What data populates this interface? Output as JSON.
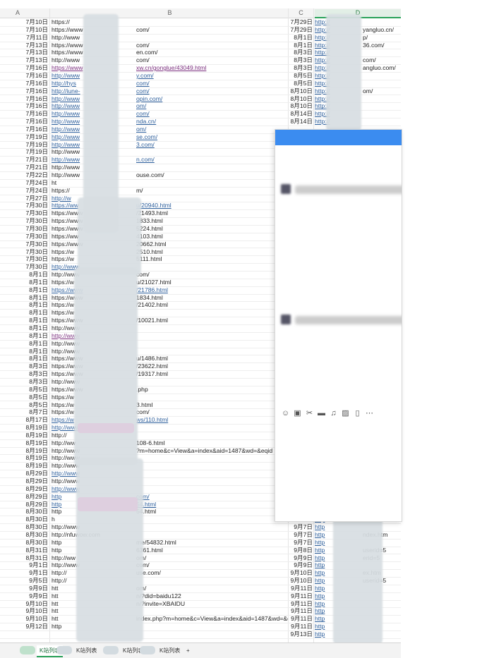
{
  "sheet": {
    "columns": [
      "A",
      "B",
      "C",
      "D"
    ],
    "rows": [
      {
        "a": "7月10日",
        "b": "https://",
        "bs": "",
        "c": "7月29日",
        "d": "http://"
      },
      {
        "a": "7月10日",
        "b": "https://www",
        "bs": "",
        "c": "7月29日",
        "d": "http://"
      },
      {
        "a": "7月11日",
        "b": "http://www",
        "bs": "",
        "c": "8月1日",
        "d": "http://"
      },
      {
        "a": "7月13日",
        "b": "https://www",
        "bs": "",
        "c": "8月1日",
        "d": "http://"
      },
      {
        "a": "7月13日",
        "b": "https://www",
        "bs": "",
        "c": "8月3日",
        "d": "http://"
      },
      {
        "a": "7月13日",
        "b": "http://www",
        "bs": "",
        "c": "8月3日",
        "d": "http://"
      },
      {
        "a": "7月16日",
        "b": "https://www",
        "bs": "visited",
        "c": "8月3日",
        "d": "http://"
      },
      {
        "a": "7月16日",
        "b": "http://www",
        "bs": "link",
        "c": "8月5日",
        "d": "http://"
      },
      {
        "a": "7月16日",
        "b": "http://hys",
        "bs": "link",
        "c": "8月5日",
        "d": "http://"
      },
      {
        "a": "7月16日",
        "b": "http://iune-",
        "bs": "link",
        "c": "8月10日",
        "d": "http://"
      },
      {
        "a": "7月16日",
        "b": "http://www",
        "bs": "link",
        "c": "8月10日",
        "d": "http://"
      },
      {
        "a": "7月16日",
        "b": "http://www",
        "bs": "link",
        "c": "8月10日",
        "d": "http://"
      },
      {
        "a": "7月16日",
        "b": "http://www",
        "bs": "link",
        "c": "8月14日",
        "d": "http://"
      },
      {
        "a": "7月16日",
        "b": "http://www",
        "bs": "link",
        "c": "8月14日",
        "d": "http://"
      },
      {
        "a": "7月16日",
        "b": "http://www",
        "bs": "link",
        "c": "",
        "d": ""
      },
      {
        "a": "7月19日",
        "b": "http://www",
        "bs": "link",
        "c": "",
        "d": ""
      },
      {
        "a": "7月19日",
        "b": "http://www",
        "bs": "link",
        "c": "",
        "d": ""
      },
      {
        "a": "7月19日",
        "b": "http://www",
        "bs": "",
        "c": "",
        "d": ""
      },
      {
        "a": "7月21日",
        "b": "http://www",
        "bs": "link",
        "c": "",
        "d": ""
      },
      {
        "a": "7月21日",
        "b": "http://www",
        "bs": "",
        "c": "",
        "d": ""
      },
      {
        "a": "7月22日",
        "b": "http://www",
        "bs": "",
        "c": "",
        "d": ""
      },
      {
        "a": "7月24日",
        "b": "ht",
        "bs": "",
        "c": "",
        "d": ""
      },
      {
        "a": "7月24日",
        "b": "https://",
        "bs": "",
        "c": "",
        "d": ""
      },
      {
        "a": "7月27日",
        "b": "http://w",
        "bs": "link",
        "c": "",
        "d": ""
      },
      {
        "a": "7月30日",
        "b": "https://ww",
        "bs": "link",
        "c": "",
        "d": ""
      },
      {
        "a": "7月30日",
        "b": "https://www",
        "bs": "",
        "c": "",
        "d": ""
      },
      {
        "a": "7月30日",
        "b": "https://www",
        "bs": "",
        "c": "",
        "d": ""
      },
      {
        "a": "7月30日",
        "b": "https://www",
        "bs": "",
        "c": "",
        "d": ""
      },
      {
        "a": "7月30日",
        "b": "https://ww",
        "bs": "",
        "c": "",
        "d": ""
      },
      {
        "a": "7月30日",
        "b": "https://www",
        "bs": "",
        "c": "",
        "d": ""
      },
      {
        "a": "7月30日",
        "b": "https://w",
        "bs": "",
        "c": "",
        "d": ""
      },
      {
        "a": "7月30日",
        "b": "https://w",
        "bs": "",
        "c": "",
        "d": ""
      },
      {
        "a": "7月30日",
        "b": "http://www",
        "bs": "link",
        "c": "",
        "d": ""
      },
      {
        "a": "8月1日",
        "b": "http://www",
        "bs": "",
        "c": "",
        "d": ""
      },
      {
        "a": "8月1日",
        "b": "https://w",
        "bs": "",
        "c": "",
        "d": ""
      },
      {
        "a": "8月1日",
        "b": "https://www",
        "bs": "link",
        "c": "",
        "d": ""
      },
      {
        "a": "8月1日",
        "b": "https://www",
        "bs": "",
        "c": "",
        "d": ""
      },
      {
        "a": "8月1日",
        "b": "https://w",
        "bs": "",
        "c": "",
        "d": ""
      },
      {
        "a": "8月1日",
        "b": "https://w",
        "bs": "",
        "c": "",
        "d": ""
      },
      {
        "a": "8月1日",
        "b": "https://www",
        "bs": "",
        "c": "",
        "d": ""
      },
      {
        "a": "8月1日",
        "b": "http://www",
        "bs": "",
        "c": "",
        "d": ""
      },
      {
        "a": "8月1日",
        "b": "http://www",
        "bs": "visited",
        "c": "",
        "d": ""
      },
      {
        "a": "8月1日",
        "b": "http://www",
        "bs": "",
        "c": "",
        "d": ""
      },
      {
        "a": "8月1日",
        "b": "http://www",
        "bs": "",
        "c": "",
        "d": ""
      },
      {
        "a": "8月1日",
        "b": "https://www",
        "bs": "",
        "c": "",
        "d": ""
      },
      {
        "a": "8月3日",
        "b": "https://www",
        "bs": "",
        "c": "",
        "d": ""
      },
      {
        "a": "8月3日",
        "b": "https://www",
        "bs": "",
        "c": "",
        "d": ""
      },
      {
        "a": "8月3日",
        "b": "http://www",
        "bs": "",
        "c": "",
        "d": ""
      },
      {
        "a": "8月5日",
        "b": "https://www",
        "bs": "",
        "c": "",
        "d": ""
      },
      {
        "a": "8月5日",
        "b": "https://w",
        "bs": "",
        "c": "",
        "d": ""
      },
      {
        "a": "8月5日",
        "b": "https://w",
        "bs": "",
        "c": "",
        "d": ""
      },
      {
        "a": "8月7日",
        "b": "https://w",
        "bs": "",
        "c": "",
        "d": ""
      },
      {
        "a": "8月17日",
        "b": "https://w",
        "bs": "link",
        "c": "",
        "d": ""
      },
      {
        "a": "8月19日",
        "b": "http://www",
        "bs": "link",
        "c": "",
        "d": ""
      },
      {
        "a": "8月19日",
        "b": "http://",
        "bs": "",
        "c": "",
        "d": ""
      },
      {
        "a": "8月19日",
        "b": "http://ww",
        "bs": "",
        "c": "",
        "d": ""
      },
      {
        "a": "8月19日",
        "b": "http://www",
        "bs": "",
        "c": "",
        "d": ""
      },
      {
        "a": "8月19日",
        "b": "http://www",
        "bs": "",
        "c": "",
        "d": ""
      },
      {
        "a": "8月19日",
        "b": "http://www",
        "bs": "",
        "c": "",
        "d": ""
      },
      {
        "a": "8月29日",
        "b": "http://www",
        "bs": "link",
        "c": "",
        "d": ""
      },
      {
        "a": "8月29日",
        "b": "http://www",
        "bs": "",
        "c": "",
        "d": ""
      },
      {
        "a": "8月29日",
        "b": "http://www",
        "bs": "link",
        "c": "",
        "d": ""
      },
      {
        "a": "8月29日",
        "b": "http",
        "bs": "link",
        "c": "",
        "d": ""
      },
      {
        "a": "8月29日",
        "b": "http",
        "bs": "link",
        "c": "",
        "d": ""
      },
      {
        "a": "8月30日",
        "b": "http",
        "bs": "",
        "c": "",
        "d": ""
      },
      {
        "a": "8月30日",
        "b": "h",
        "bs": "",
        "c": "9月7日",
        "d": "http"
      },
      {
        "a": "8月30日",
        "b": "http://www",
        "bs": "",
        "c": "9月7日",
        "d": "http"
      },
      {
        "a": "8月30日",
        "b": "http://nfuwow.com",
        "bs": "",
        "c": "9月7日",
        "d": "http"
      },
      {
        "a": "8月30日",
        "b": "http",
        "bs": "",
        "c": "9月7日",
        "d": "http"
      },
      {
        "a": "8月31日",
        "b": "http",
        "bs": "",
        "c": "9月8日",
        "d": "http"
      },
      {
        "a": "8月31日",
        "b": "http://ww",
        "bs": "",
        "c": "9月9日",
        "d": "http"
      },
      {
        "a": "9月1日",
        "b": "http://www",
        "bs": "",
        "c": "9月9日",
        "d": "http"
      },
      {
        "a": "9月1日",
        "b": "http://",
        "bs": "",
        "c": "9月10日",
        "d": "http"
      },
      {
        "a": "9月5日",
        "b": "http://",
        "bs": "",
        "c": "9月10日",
        "d": "http"
      },
      {
        "a": "9月9日",
        "b": "htt",
        "bs": "",
        "c": "9月11日",
        "d": "http"
      },
      {
        "a": "9月9日",
        "b": "htt",
        "bs": "",
        "c": "9月11日",
        "d": "http"
      },
      {
        "a": "9月10日",
        "b": "htt",
        "bs": "",
        "c": "9月11日",
        "d": "http"
      },
      {
        "a": "9月10日",
        "b": "htt",
        "bs": "",
        "c": "9月11日",
        "d": "http"
      },
      {
        "a": "9月10日",
        "b": "htt",
        "bs": "",
        "c": "9月11日",
        "d": "http"
      },
      {
        "a": "9月12日",
        "b": "http",
        "bs": "",
        "c": "9月11日",
        "d": "http"
      },
      {
        "a": "",
        "b": "",
        "bs": "",
        "c": "9月13日",
        "d": "http"
      }
    ],
    "b_tails": [
      "",
      "com/",
      "",
      "com/",
      "en.com/",
      "com/",
      "xw.cn/gonglue/43049.html",
      "y.com/",
      "com/",
      "com/",
      "opin.com/",
      "om/",
      "com/",
      "nda.cn/",
      "om/",
      "se.com/",
      "3.com/",
      "",
      "n.com/",
      "",
      "ouse.com/",
      "",
      "m/",
      "",
      "u/20940.html",
      "/21493.html",
      "1833.html",
      "5224.html",
      "4103.html",
      "20662.html",
      "2510.html",
      "5111.html",
      "",
      "com/",
      "u/21027.html",
      "/21786.html",
      "1834.html",
      "/21402.html",
      "",
      "/10021.html",
      "",
      "",
      "",
      "",
      "u/1486.html",
      "/23622.html",
      "/19317.html",
      "",
      ".php",
      "",
      "3.html",
      "com/",
      "ws/110.html",
      "",
      "",
      "108-6.html",
      "?m=home&c=View&a=index&aid=1487&wd=&eqid",
      "",
      "",
      "",
      "",
      "",
      "com/",
      "54.html",
      "54.html",
      "",
      "",
      "",
      "me/54832.html",
      "6361.html",
      "om/",
      "com/",
      "use.com/",
      "",
      "om/",
      "n/?did=baidu122",
      "n/?invite=XBAIDU",
      "",
      "index.php?m=home&c=View&a=index&aid=1487&wd=&eqid=ec9985020004bf",
      ""
    ],
    "d_tails": [
      "",
      "yangluo.cn/",
      "p/",
      "36.com/",
      "",
      "com/",
      "angluo.com/",
      "",
      "",
      "om/",
      "",
      "",
      "",
      "",
      "",
      "",
      "",
      "",
      "",
      "",
      "",
      "",
      "",
      "",
      "",
      "",
      "",
      "",
      "",
      "",
      "",
      "",
      "",
      "",
      "",
      "",
      "",
      "",
      "",
      "",
      "",
      "",
      "",
      "",
      "",
      "",
      "",
      "",
      "",
      "",
      "",
      "",
      "",
      "",
      "",
      "",
      "",
      "",
      "",
      "",
      "",
      "",
      "",
      "",
      "",
      "usend=c",
      "",
      "ndex.htm",
      "",
      "userid=5",
      "erid=5",
      "",
      "ex.htm",
      "userid=5",
      "",
      "",
      "",
      ""
    ]
  },
  "tabs": [
    {
      "label": "K站列表"
    },
    {
      "label": "K站列表"
    },
    {
      "label": "K站列表"
    },
    {
      "label": "K站列表"
    },
    {
      "label": "+"
    }
  ],
  "chat": {
    "toolbar_icons": [
      "emoji-icon",
      "gif-icon",
      "scissors-icon",
      "folder-icon",
      "music-icon",
      "image-icon",
      "phone-icon",
      "more-icon"
    ],
    "toolbar_glyphs": [
      "☺",
      "▣",
      "✂",
      "▬",
      "♫",
      "▨",
      "▯",
      "⋯"
    ]
  },
  "colors": {
    "accent": "#2ba25a",
    "link": "#2c5e9b",
    "chat_bar": "#3b8cf0"
  }
}
